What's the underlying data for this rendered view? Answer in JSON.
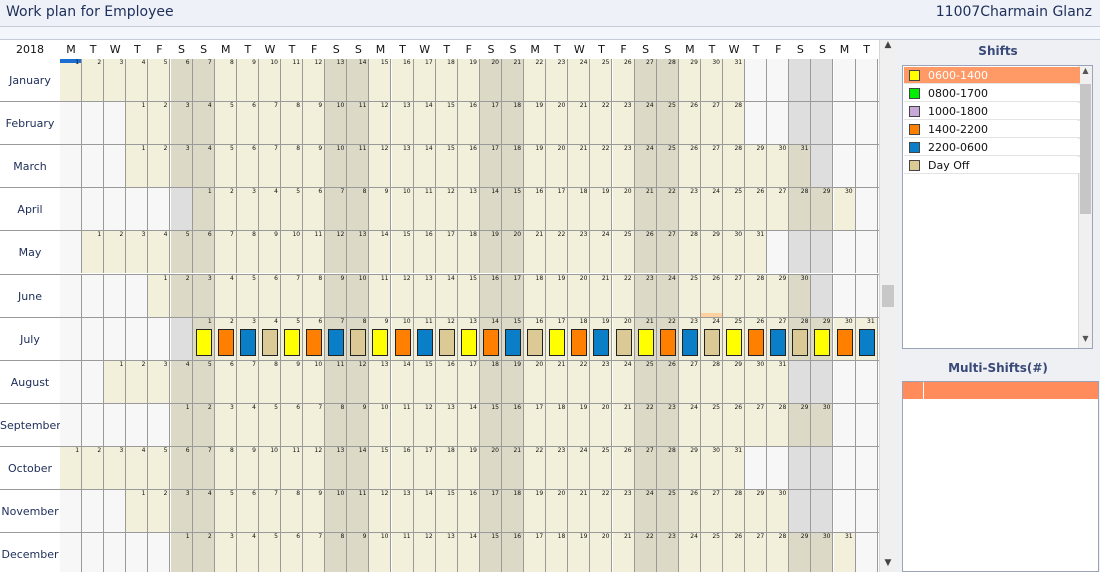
{
  "header": {
    "title": "Work plan for Employee",
    "employee": "11007Charmain Glanz"
  },
  "calendar": {
    "year": "2018",
    "weekday_headers": [
      "M",
      "T",
      "W",
      "T",
      "F",
      "S",
      "S",
      "M",
      "T",
      "W",
      "T",
      "F",
      "S",
      "S",
      "M",
      "T",
      "W",
      "T",
      "F",
      "S",
      "S",
      "M",
      "T",
      "W",
      "T",
      "F",
      "S",
      "S",
      "M",
      "T",
      "W",
      "T",
      "F",
      "S",
      "S",
      "M",
      "T"
    ],
    "months": [
      {
        "name": "January",
        "start": 0,
        "days": 31
      },
      {
        "name": "February",
        "start": 3,
        "days": 28
      },
      {
        "name": "March",
        "start": 3,
        "days": 31
      },
      {
        "name": "April",
        "start": 6,
        "days": 30
      },
      {
        "name": "May",
        "start": 1,
        "days": 31
      },
      {
        "name": "June",
        "start": 4,
        "days": 30
      },
      {
        "name": "July",
        "start": 6,
        "days": 31
      },
      {
        "name": "August",
        "start": 2,
        "days": 31
      },
      {
        "name": "September",
        "start": 5,
        "days": 30
      },
      {
        "name": "October",
        "start": 0,
        "days": 31
      },
      {
        "name": "November",
        "start": 3,
        "days": 30
      },
      {
        "name": "December",
        "start": 5,
        "days": 31
      }
    ],
    "july_shifts": [
      "0600-1400",
      "1400-2200",
      "2200-0600",
      "Day Off",
      "0600-1400",
      "1400-2200",
      "2200-0600",
      "Day Off",
      "0600-1400",
      "1400-2200",
      "2200-0600",
      "Day Off",
      "0600-1400",
      "1400-2200",
      "2200-0600",
      "Day Off",
      "0600-1400",
      "1400-2200",
      "2200-0600",
      "Day Off",
      "0600-1400",
      "1400-2200",
      "2200-0600",
      "Day Off",
      "0600-1400",
      "1400-2200",
      "2200-0600",
      "Day Off",
      "0600-1400",
      "1400-2200",
      "2200-0600"
    ]
  },
  "shifts_panel": {
    "title": "Shifts",
    "items": [
      {
        "label": "0600-1400",
        "color": "#ffff00",
        "selected": true
      },
      {
        "label": "0800-1700",
        "color": "#00ee00",
        "selected": false
      },
      {
        "label": "1000-1800",
        "color": "#c8a8d8",
        "selected": false
      },
      {
        "label": "1400-2200",
        "color": "#ff8000",
        "selected": false
      },
      {
        "label": "2200-0600",
        "color": "#0a7fc8",
        "selected": false
      },
      {
        "label": "Day Off",
        "color": "#dcca96",
        "selected": false
      }
    ]
  },
  "multi_shifts_panel": {
    "title": "Multi-Shifts(#)"
  },
  "colors": {
    "weekday_bg": "#f2f0da",
    "weekend_bg": "#dcdac6",
    "empty_bg": "#f7f7f7",
    "empty_weekend_bg": "#dedede",
    "selected_bg": "#ff9966",
    "today_marker": "#ffd0a0"
  }
}
